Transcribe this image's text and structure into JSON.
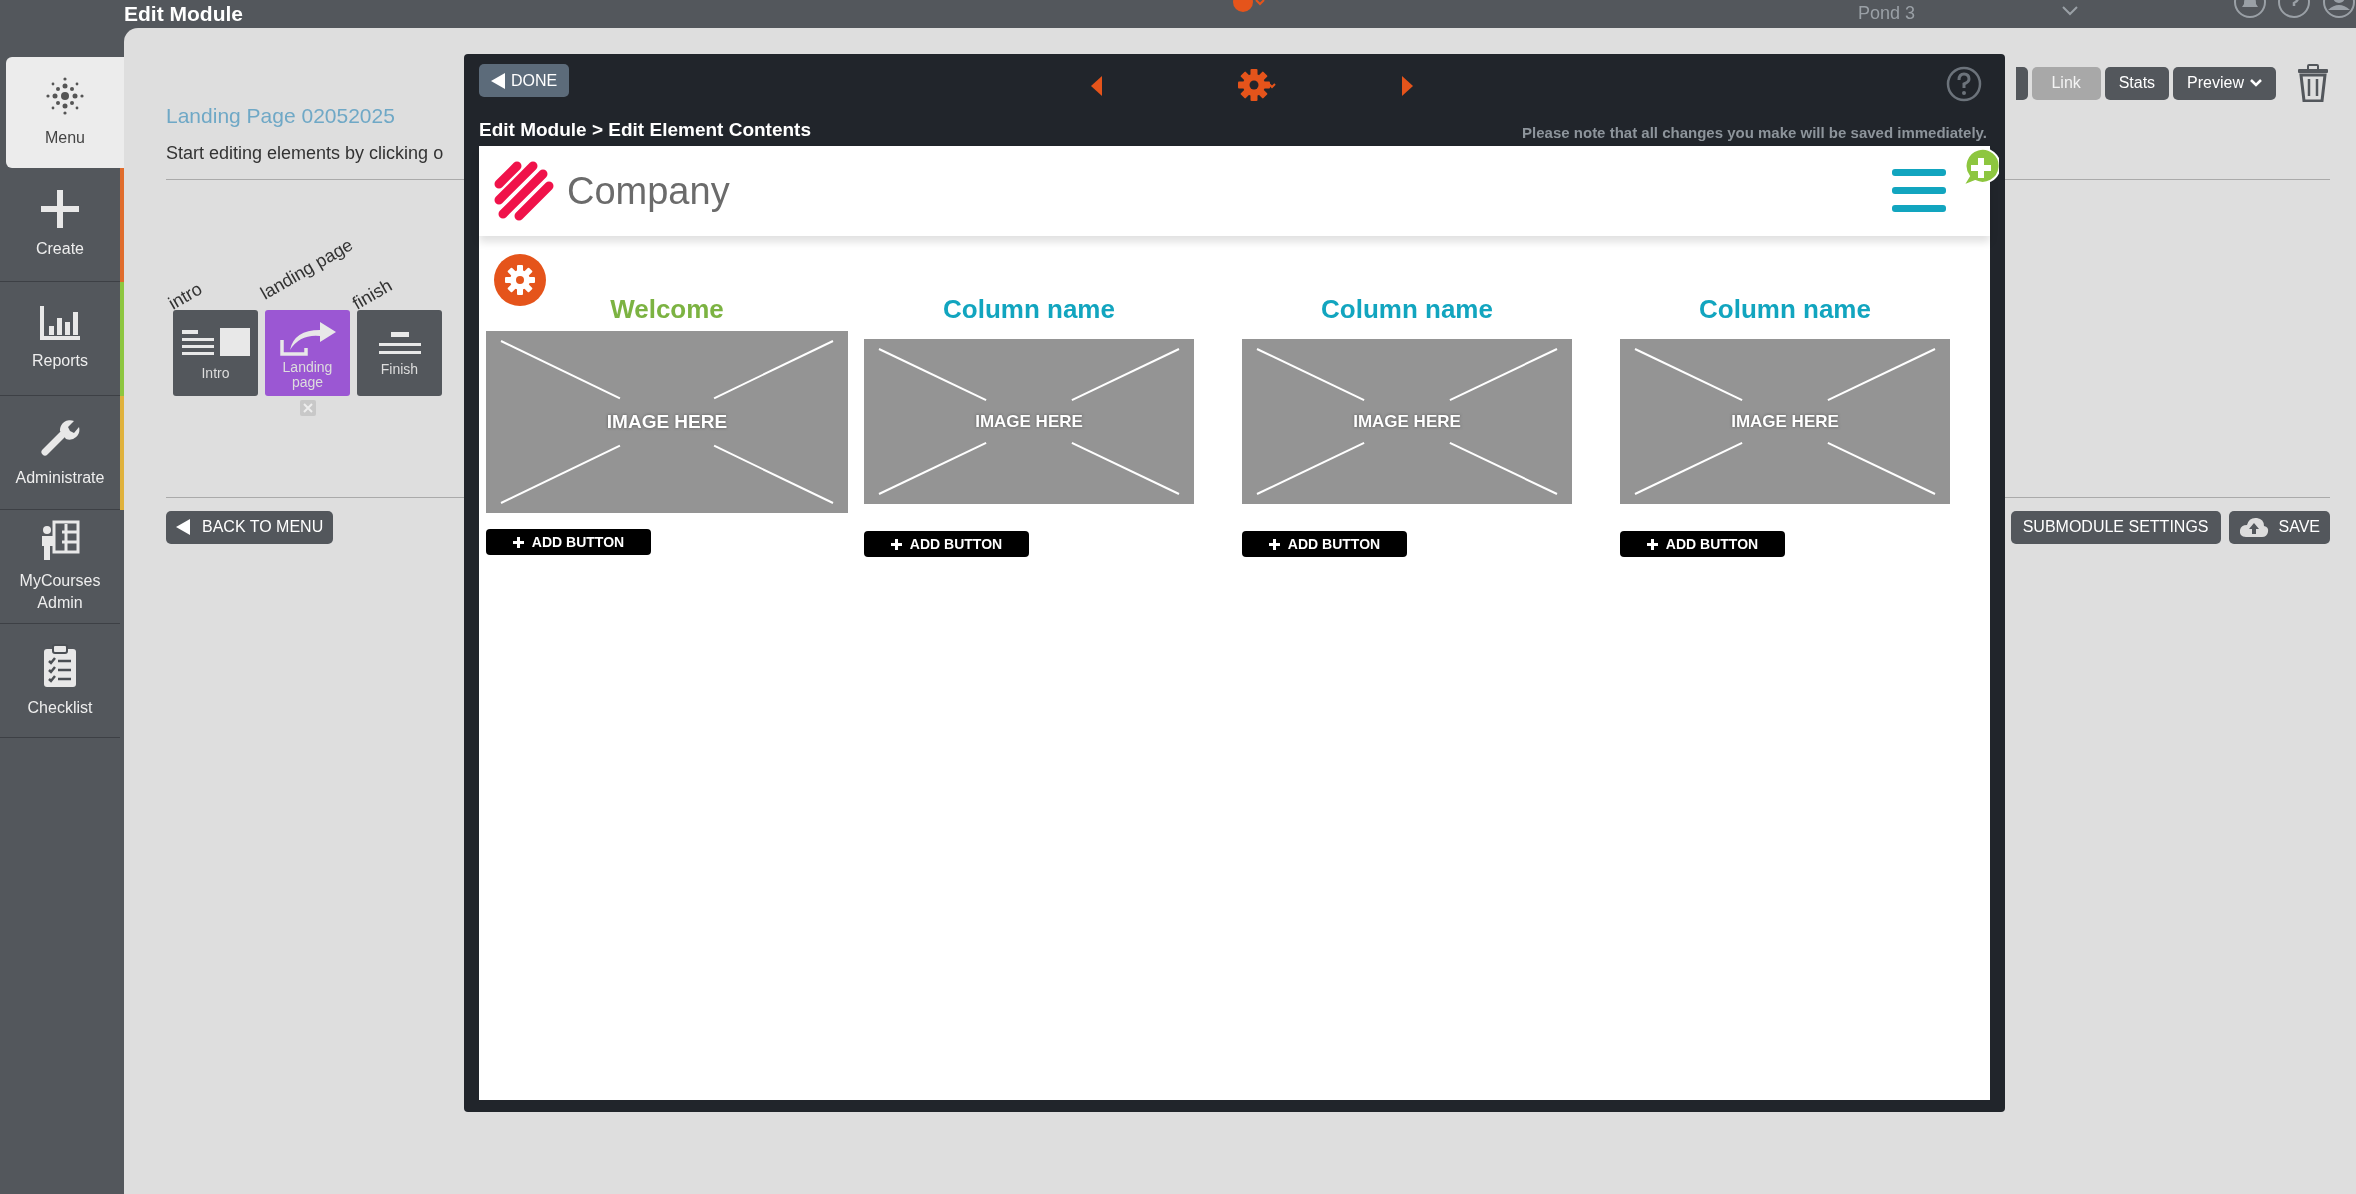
{
  "top_bar": {
    "title": "Edit Module",
    "site": "Pond 3"
  },
  "sidebar": {
    "items": [
      {
        "label": "Menu",
        "selected": true
      },
      {
        "label": "Create",
        "selected": false,
        "color": "#e06c2c"
      },
      {
        "label": "Reports",
        "selected": false,
        "color": "#8dc63f"
      },
      {
        "label": "Administrate",
        "selected": false,
        "color": "#e0b23c"
      },
      {
        "label": "MyCourses Admin",
        "selected": false
      },
      {
        "label": "Checklist",
        "selected": false
      }
    ]
  },
  "module": {
    "title": "Landing Page 02052025",
    "instruction": "Start editing elements by clicking o",
    "toolbar": [
      {
        "label": "Link",
        "disabled": true
      },
      {
        "label": "Stats",
        "disabled": false
      },
      {
        "label": "Preview",
        "disabled": false
      }
    ],
    "elements": [
      {
        "caption": "intro",
        "label": "Intro",
        "selected": false
      },
      {
        "caption": "landing page",
        "label": "Landing page",
        "selected": true
      },
      {
        "caption": "finish",
        "label": "Finish",
        "selected": false
      }
    ],
    "back_button": "BACK TO MENU",
    "settings_button": "SUBMODULE SETTINGS",
    "save_button": "SAVE"
  },
  "modal": {
    "done_button": "DONE",
    "breadcrumb": "Edit Module > Edit Element Contents",
    "note": "Please note that all changes you make will be saved immediately.",
    "content": {
      "logo_text": "Company",
      "columns": [
        {
          "title": "Welcome",
          "color": "#7cb342",
          "image_text": "IMAGE HERE",
          "button": "ADD BUTTON"
        },
        {
          "title": "Column name",
          "color": "#12a5bf",
          "image_text": "IMAGE HERE",
          "button": "ADD BUTTON"
        },
        {
          "title": "Column name",
          "color": "#12a5bf",
          "image_text": "IMAGE HERE",
          "button": "ADD BUTTON"
        },
        {
          "title": "Column name",
          "color": "#12a5bf",
          "image_text": "IMAGE HERE",
          "button": "ADD BUTTON"
        }
      ]
    }
  }
}
